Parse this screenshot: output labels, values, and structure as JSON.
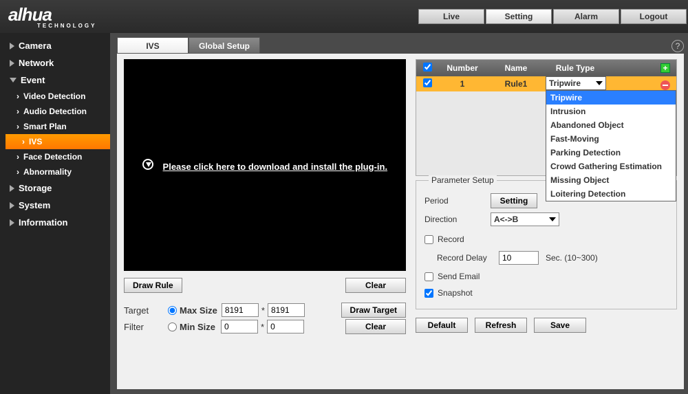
{
  "brand": {
    "name": "alhua",
    "tagline": "TECHNOLOGY"
  },
  "topnav": {
    "live": "Live",
    "setting": "Setting",
    "alarm": "Alarm",
    "logout": "Logout"
  },
  "sidebar": {
    "camera": "Camera",
    "network": "Network",
    "event": "Event",
    "storage": "Storage",
    "system": "System",
    "information": "Information",
    "event_items": {
      "video_detection": "Video Detection",
      "audio_detection": "Audio Detection",
      "smart_plan": "Smart Plan",
      "ivs": "IVS",
      "face_detection": "Face Detection",
      "abnormality": "Abnormality"
    }
  },
  "tabs": {
    "ivs": "IVS",
    "global": "Global Setup"
  },
  "help_symbol": "?",
  "video": {
    "link": "Please click here to download and install the plug-in."
  },
  "buttons": {
    "draw_rule": "Draw Rule",
    "clear": "Clear",
    "draw_target": "Draw Target",
    "setting": "Setting",
    "default": "Default",
    "refresh": "Refresh",
    "save": "Save"
  },
  "target_filter": {
    "label": "Target Filter",
    "max": "Max Size",
    "max_w": "8191",
    "max_h": "8191",
    "min": "Min Size",
    "min_w": "0",
    "min_h": "0",
    "sep": "*"
  },
  "rule_table": {
    "headers": {
      "number": "Number",
      "name": "Name",
      "type": "Rule Type"
    },
    "rows": [
      {
        "number": "1",
        "name": "Rule1",
        "type": "Tripwire"
      }
    ],
    "dropdown": [
      "Tripwire",
      "Intrusion",
      "Abandoned Object",
      "Fast-Moving",
      "Parking Detection",
      "Crowd Gathering Estimation",
      "Missing Object",
      "Loitering Detection"
    ]
  },
  "params": {
    "legend": "Parameter Setup",
    "period": "Period",
    "direction": "Direction",
    "direction_value": "A<->B",
    "record": "Record",
    "record_delay": "Record Delay",
    "record_delay_value": "10",
    "record_delay_hint": "Sec. (10~300)",
    "send_email": "Send Email",
    "snapshot": "Snapshot"
  }
}
